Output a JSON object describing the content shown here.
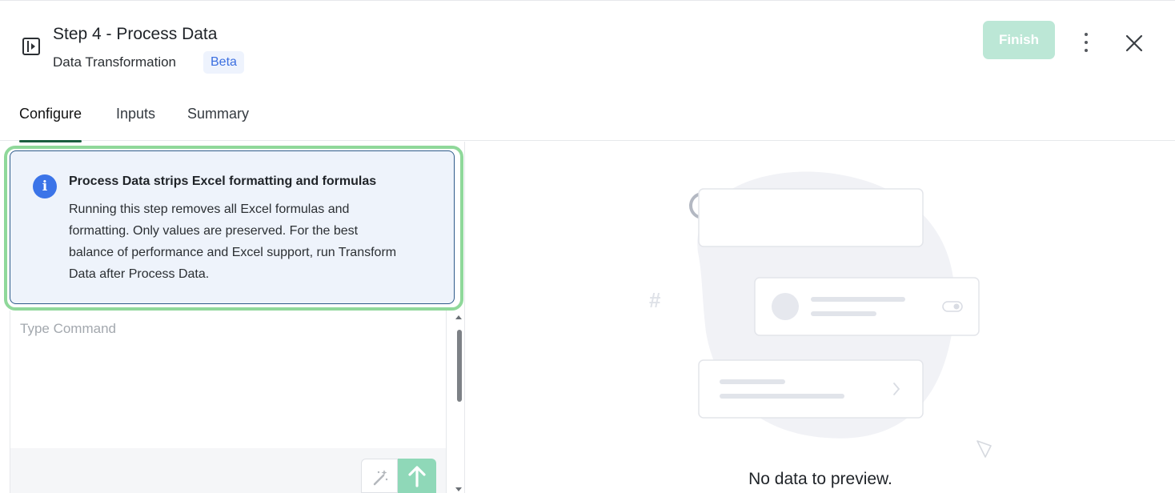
{
  "header": {
    "title": "Step 4 - Process Data",
    "subtitle": "Data Transformation",
    "badge": "Beta",
    "finish_label": "Finish"
  },
  "tabs": [
    {
      "label": "Configure",
      "active": true
    },
    {
      "label": "Inputs",
      "active": false
    },
    {
      "label": "Summary",
      "active": false
    }
  ],
  "info": {
    "title": "Process Data strips Excel formatting and formulas",
    "body": "Running this step removes all Excel formulas and formatting. Only values are preserved. For the best balance of performance and Excel support, run Transform Data after Process Data."
  },
  "command": {
    "placeholder": "Type Command",
    "value": ""
  },
  "preview": {
    "empty_text": "No data to preview."
  },
  "icons": {
    "panel_toggle": "panel-toggle-icon",
    "kebab": "kebab-menu-icon",
    "close": "close-icon",
    "info": "info-icon",
    "magic": "magic-wand-icon",
    "send": "arrow-up-icon"
  },
  "colors": {
    "accent_green": "#1b5e40",
    "finish_disabled": "#bce7d6",
    "info_blue": "#3b74e8",
    "highlight_green": "#8fd89a",
    "send_green": "#8fd8b8"
  }
}
